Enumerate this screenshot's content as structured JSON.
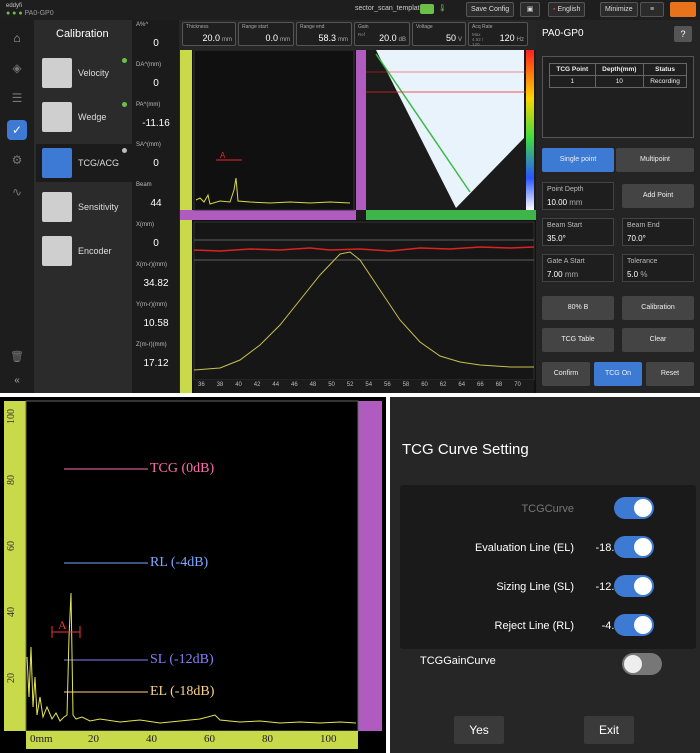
{
  "status": {
    "brand": "PA0-GP0",
    "file": "sector_scan_template",
    "save": "Save Config",
    "language": "English",
    "minimize": "Minimize"
  },
  "calibration": {
    "title": "Calibration",
    "items": [
      {
        "label": "Velocity"
      },
      {
        "label": "Wedge"
      },
      {
        "label": "TCG/ACG"
      },
      {
        "label": "Sensitivity"
      },
      {
        "label": "Encoder"
      }
    ]
  },
  "toolbar": [
    {
      "label": "Thickness",
      "value": "20.0",
      "unit": "mm"
    },
    {
      "label": "Range start",
      "value": "0.0",
      "unit": "mm"
    },
    {
      "label": "Range end",
      "value": "58.3",
      "unit": "mm"
    },
    {
      "label": "Gain",
      "sub": "Ref",
      "value": "20.0",
      "unit": "dB"
    },
    {
      "label": "Voltage",
      "value": "50",
      "unit": "V"
    },
    {
      "label": "Acq Rate",
      "sub": "Max 4.52 / 120",
      "value": "120",
      "unit": "Hz"
    }
  ],
  "readouts": [
    {
      "label": "A%^",
      "value": "0"
    },
    {
      "label": "DA^(mm)",
      "value": "0"
    },
    {
      "label": "PA^(mm)",
      "value": "-11.16"
    },
    {
      "label": "SA^(mm)",
      "value": "0"
    },
    {
      "label": "Beam",
      "value": "44"
    },
    {
      "label": "X(mm)",
      "value": "0"
    },
    {
      "label": "X(m-r)(mm)",
      "value": "34.82"
    },
    {
      "label": "Y(m-r)(mm)",
      "value": "10.58"
    },
    {
      "label": "Z(m-r)(mm)",
      "value": "17.12"
    }
  ],
  "scale_labels": [
    "36",
    "38",
    "40",
    "42",
    "44",
    "46",
    "48",
    "50",
    "52",
    "54",
    "56",
    "58",
    "60",
    "62",
    "64",
    "66",
    "68",
    "70"
  ],
  "gate_marker": "A",
  "panel": {
    "title": "PA0-GP0",
    "help": "?",
    "table_headers": [
      "TCG Point",
      "Depth(mm)",
      "Status"
    ],
    "table_rows": [
      [
        "1",
        "10",
        "Recording"
      ]
    ],
    "mode_single": "Single point",
    "mode_multi": "Multipoint",
    "point_depth_label": "Point Depth",
    "point_depth": "10.00",
    "point_depth_unit": "mm",
    "add_point": "Add Point",
    "beam_start_label": "Beam Start",
    "beam_start": "35.0",
    "beam_end_label": "Beam End",
    "beam_end": "70.0",
    "gate_start_label": "Gate A Start",
    "gate_start": "7.00",
    "gate_start_unit": "mm",
    "tolerance_label": "Tolerance",
    "tolerance": "5.0",
    "tolerance_unit": "%",
    "btn_80": "80% B",
    "btn_cal": "Calibration",
    "btn_table": "TCG Table",
    "btn_clear": "Clear",
    "btn_confirm": "Confirm",
    "btn_tcg_on": "TCG On",
    "btn_reset": "Reset"
  },
  "zoom": {
    "lines": [
      {
        "label": "TCG (0dB)",
        "color": "#ff6fb0"
      },
      {
        "label": "RL (-4dB)",
        "color": "#7fa8ff"
      },
      {
        "label": "SL (-12dB)",
        "color": "#8a7dff"
      },
      {
        "label": "EL (-18dB)",
        "color": "#ffd38a"
      }
    ],
    "xticks": [
      "0mm",
      "20",
      "40",
      "60",
      "80",
      "100"
    ],
    "yticks": [
      "100",
      "80",
      "60",
      "40",
      "20"
    ],
    "gate": "A"
  },
  "dialog": {
    "title": "TCG Curve Setting",
    "rows": [
      {
        "label": "TCGCurve",
        "db": "",
        "on": true,
        "dim": true
      },
      {
        "label": "Evaluation Line (EL)",
        "db": "-18.0dB",
        "on": true
      },
      {
        "label": "Sizing Line (SL)",
        "db": "-12.0dB",
        "on": true
      },
      {
        "label": "Reject Line (RL)",
        "db": "-4.0dB",
        "on": true
      }
    ],
    "gain_curve": "TCGGainCurve",
    "gain_on": false,
    "yes": "Yes",
    "exit": "Exit"
  }
}
